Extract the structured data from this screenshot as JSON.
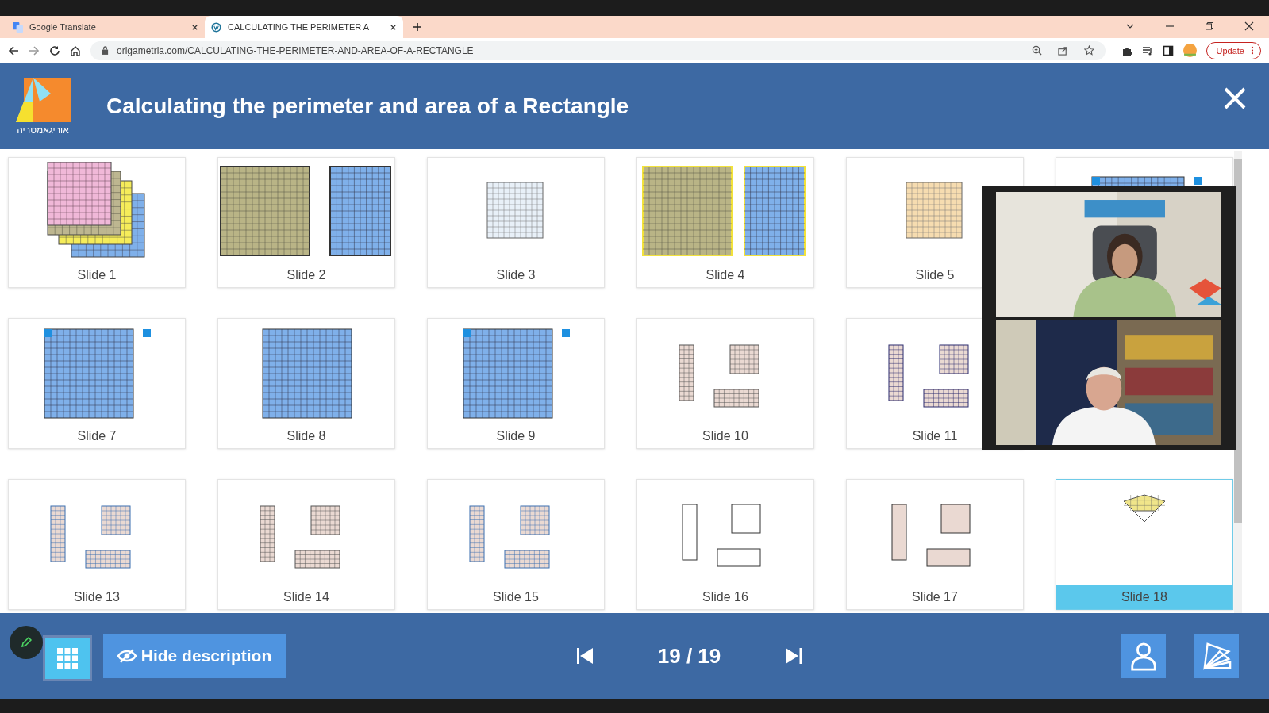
{
  "browser": {
    "tabs": [
      {
        "title": "Google Translate",
        "selected": false
      },
      {
        "title": "CALCULATING THE PERIMETER A",
        "selected": true
      }
    ],
    "url": "origametria.com/CALCULATING-THE-PERIMETER-AND-AREA-OF-A-RECTANGLE",
    "update_button": "Update"
  },
  "header": {
    "logo_text": "אוריגאמטריה",
    "title": "Calculating the perimeter and area of a Rectangle"
  },
  "slides": [
    {
      "label": "Slide 1",
      "kind": "stack",
      "selected": false
    },
    {
      "label": "Slide 2",
      "kind": "two-squares",
      "selected": false
    },
    {
      "label": "Slide 3",
      "kind": "small-grid",
      "selected": false
    },
    {
      "label": "Slide 4",
      "kind": "two-squares-framed",
      "selected": false
    },
    {
      "label": "Slide 5",
      "kind": "small-grid-warm",
      "selected": false
    },
    {
      "kind": "top-strip",
      "selected": false
    },
    {
      "label": "Slide 7",
      "kind": "big-square-markers",
      "selected": false
    },
    {
      "label": "Slide 8",
      "kind": "big-square",
      "selected": false
    },
    {
      "label": "Slide 9",
      "kind": "big-square-markers",
      "selected": false
    },
    {
      "label": "Slide 10",
      "kind": "three-rects",
      "selected": false
    },
    {
      "label": "Slide 11",
      "kind": "three-rects-dark",
      "selected": false
    },
    {
      "kind": "covered"
    },
    {
      "label": "Slide 13",
      "kind": "three-rects-blue",
      "selected": false
    },
    {
      "label": "Slide 14",
      "kind": "three-rects",
      "selected": false
    },
    {
      "label": "Slide 15",
      "kind": "three-rects-blue",
      "selected": false
    },
    {
      "label": "Slide 16",
      "kind": "outline-rects",
      "selected": false
    },
    {
      "label": "Slide 17",
      "kind": "outline-rects-shaded",
      "selected": false
    },
    {
      "label": "Slide 18",
      "kind": "origami",
      "selected": true
    }
  ],
  "footer": {
    "hide_button": "Hide description",
    "counter": "19 / 19"
  }
}
